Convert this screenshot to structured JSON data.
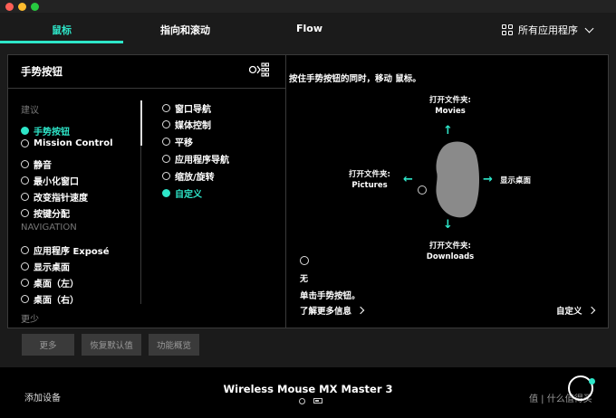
{
  "tabs": [
    {
      "label": "鼠标",
      "active": true
    },
    {
      "label": "指向和滚动",
      "active": false
    },
    {
      "label": "Flow",
      "active": false
    }
  ],
  "apps_selector": {
    "label": "所有应用程序",
    "icon": "grid-icon"
  },
  "panel": {
    "title": "手势按钮",
    "hint": "按住手势按钮的同时，移动 鼠标。",
    "suggest_label": "建议",
    "navigation_label": "NAVIGATION",
    "less_label": "更少",
    "left_options": [
      {
        "label": "手势按钮",
        "selected": true
      },
      {
        "label": "Mission Control",
        "selected": false
      },
      {
        "label": "静音",
        "selected": false
      },
      {
        "label": "最小化窗口",
        "selected": false
      },
      {
        "label": "改变指针速度",
        "selected": false
      },
      {
        "label": "按键分配",
        "selected": false
      }
    ],
    "nav_options": [
      {
        "label": "应用程序 Exposé",
        "selected": false
      },
      {
        "label": "显示桌面",
        "selected": false
      },
      {
        "label": "桌面（左）",
        "selected": false
      },
      {
        "label": "桌面（右）",
        "selected": false
      }
    ],
    "sub_options": [
      {
        "label": "窗口导航",
        "selected": false
      },
      {
        "label": "媒体控制",
        "selected": false
      },
      {
        "label": "平移",
        "selected": false
      },
      {
        "label": "应用程序导航",
        "selected": false
      },
      {
        "label": "缩放/旋转",
        "selected": false
      },
      {
        "label": "自定义",
        "selected": true
      }
    ],
    "directions": {
      "up": "打开文件夹:\nMovies",
      "left": "打开文件夹:\nPictures",
      "right": "显示桌面",
      "down": "打开文件夹:\nDownloads"
    },
    "none_label": "无",
    "click_label": "单击手势按钮。",
    "learn_more": "了解更多信息",
    "custom_link": "自定义"
  },
  "buttons": {
    "more": "更多",
    "restore": "恢复默认值",
    "overview": "功能概览"
  },
  "footer": {
    "add_device": "添加设备",
    "device_name": "Wireless Mouse MX Master 3",
    "watermark": "值 | 什么值得买"
  },
  "colors": {
    "accent": "#2ee6c9",
    "background": "#1b1b1b",
    "panel": "#000000"
  }
}
